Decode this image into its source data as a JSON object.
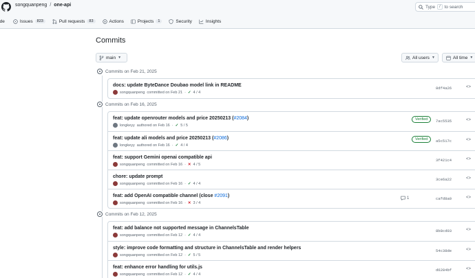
{
  "header": {
    "owner": "songquanpeng",
    "separator": "/",
    "repo": "one-api",
    "search_text_1": "Type",
    "search_key": "/",
    "search_text_2": "to search"
  },
  "tabs": [
    {
      "label": "ode",
      "count": ""
    },
    {
      "label": "Issues",
      "count": "823"
    },
    {
      "label": "Pull requests",
      "count": "83"
    },
    {
      "label": "Actions",
      "count": ""
    },
    {
      "label": "Projects",
      "count": "1"
    },
    {
      "label": "Security",
      "count": ""
    },
    {
      "label": "Insights",
      "count": ""
    }
  ],
  "page": {
    "title": "Commits",
    "branch": "main",
    "users_filter": "All users",
    "time_filter": "All time"
  },
  "groups": [
    {
      "heading": "Commits on Feb 21, 2025",
      "commits": [
        {
          "title": "docs: update ByteDance Doubao model link in README",
          "pr": "",
          "close": "",
          "author": "songquanpeng",
          "action": "committed on Feb 21",
          "status": "ok",
          "checks": "4 / 4",
          "verified": "",
          "comments": "",
          "sha": "8df4a26"
        }
      ]
    },
    {
      "heading": "Commits on Feb 16, 2025",
      "commits": [
        {
          "title": "feat: update openrouter models and price 20250213 (",
          "pr": "#2084",
          "close": ")",
          "author": "longkeyy",
          "action": "authored on Feb 16",
          "status": "ok",
          "checks": "5 / 5",
          "verified": "Verified",
          "comments": "",
          "sha": "7ac5535"
        },
        {
          "title": "feat: update ali models and price 20250213 (",
          "pr": "#2086",
          "close": ")",
          "author": "longkeyy",
          "action": "authored on Feb 16",
          "status": "ok",
          "checks": "4 / 4",
          "verified": "Verified",
          "comments": "",
          "sha": "a5c517c"
        },
        {
          "title": "feat: support Gemini openai compatible api",
          "pr": "",
          "close": "",
          "author": "songquanpeng",
          "action": "committed on Feb 16",
          "status": "bad",
          "checks": "4 / 5",
          "verified": "",
          "comments": "",
          "sha": "3f421c4"
        },
        {
          "title": "chore: update prompt",
          "pr": "",
          "close": "",
          "author": "songquanpeng",
          "action": "committed on Feb 16",
          "status": "ok",
          "checks": "4 / 4",
          "verified": "",
          "comments": "",
          "sha": "3ce6a22"
        },
        {
          "title": "feat: add OpenAI compatible channel (close ",
          "pr": "#2091",
          "close": ")",
          "author": "songquanpeng",
          "action": "committed on Feb 16",
          "status": "bad",
          "checks": "3 / 4",
          "verified": "",
          "comments": "1",
          "sha": "cafd8a0"
        }
      ]
    },
    {
      "heading": "Commits on Feb 12, 2025",
      "commits": [
        {
          "title": "feat: add balance not supported message in ChannelsTable",
          "pr": "",
          "close": "",
          "author": "songquanpeng",
          "action": "committed on Feb 12",
          "status": "ok",
          "checks": "4 / 4",
          "verified": "",
          "comments": "",
          "sha": "8b8cd03"
        },
        {
          "title": "style: improve code formatting and structure in ChannelsTable and render helpers",
          "pr": "",
          "close": "",
          "author": "songquanpeng",
          "action": "committed on Feb 12",
          "status": "ok",
          "checks": "5 / 5",
          "verified": "",
          "comments": "",
          "sha": "54c38de"
        },
        {
          "title": "feat: enhance error handling for utils.js",
          "pr": "",
          "close": "",
          "author": "songquanpeng",
          "action": "committed on Feb 12",
          "status": "ok",
          "checks": "4 / 4",
          "verified": "",
          "comments": "",
          "sha": "d6284bf"
        }
      ]
    }
  ],
  "icons": {
    "ok": "✓",
    "bad": "✕",
    "dot": "·",
    "browse": "<>"
  }
}
